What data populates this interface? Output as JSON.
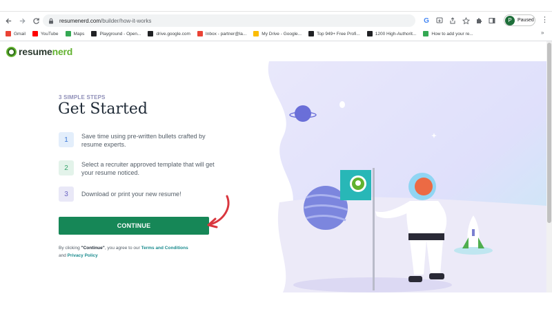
{
  "browser": {
    "url_host": "resumenerd.com",
    "url_path": "/builder/how-it-works",
    "profile_initial": "P",
    "profile_status": "Paused",
    "bookmarks": [
      {
        "label": "Gmail",
        "color": "#ea4335"
      },
      {
        "label": "YouTube",
        "color": "#ff0000"
      },
      {
        "label": "Maps",
        "color": "#34a853"
      },
      {
        "label": "Playground - Open...",
        "color": "#202124"
      },
      {
        "label": "drive.google.com",
        "color": "#202124"
      },
      {
        "label": "Inbox - partner@la...",
        "color": "#ea4335"
      },
      {
        "label": "My Drive - Google...",
        "color": "#fbbc04"
      },
      {
        "label": "Top 949+ Free Profi...",
        "color": "#202124"
      },
      {
        "label": "1200 High-Authorit...",
        "color": "#202124"
      },
      {
        "label": "How to add your re...",
        "color": "#34a853"
      }
    ],
    "bookmarks_more": "»"
  },
  "logo": {
    "part1": "resume",
    "part2": "nerd",
    "brand_color": "#62b22f"
  },
  "hero": {
    "eyebrow": "3 SIMPLE STEPS",
    "title": "Get Started"
  },
  "steps": [
    {
      "number": "1",
      "text": "Save time using pre-written bullets crafted by resume experts."
    },
    {
      "number": "2",
      "text": "Select a recruiter approved template that will get your resume noticed."
    },
    {
      "number": "3",
      "text": "Download or print your new resume!"
    }
  ],
  "cta": {
    "label": "CONTINUE",
    "color": "#168757"
  },
  "legal": {
    "prefix": "By clicking ",
    "bold": "\"Continue\"",
    "middle": ", you agree to our ",
    "terms": "Terms and Conditions",
    "and": " and ",
    "privacy": "Privacy Policy"
  }
}
